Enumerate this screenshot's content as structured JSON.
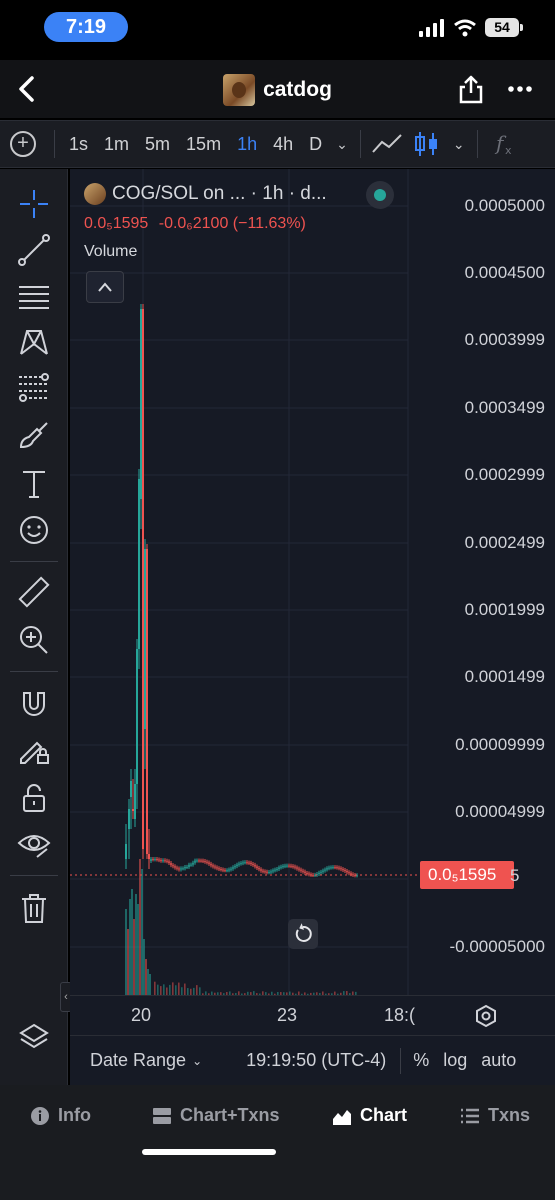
{
  "status_bar": {
    "time": "7:19",
    "battery": "54"
  },
  "header": {
    "title": "catdog"
  },
  "toolbar": {
    "intervals": [
      "1s",
      "1m",
      "5m",
      "15m",
      "1h",
      "4h",
      "D"
    ],
    "active_interval": "1h",
    "accent": "#3b82f6"
  },
  "legend": {
    "symbol": "COG/SOL on ... · 1h · d...",
    "price": "0.0₅1595",
    "change": "-0.0₆2100 (−11.63%)",
    "volume_label": "Volume",
    "down_color": "#ef5350",
    "up_color": "#26a69a"
  },
  "price_axis": {
    "labels": [
      "0.0005000",
      "0.0004500",
      "0.0003999",
      "0.0003499",
      "0.0002999",
      "0.0002499",
      "0.0001999",
      "0.0001499",
      "0.00009999",
      "0.00004999",
      "-0.00005000"
    ],
    "current_price_tag": "0.0₅1595",
    "current_price_tail": "5"
  },
  "time_axis": {
    "labels": [
      "20",
      "23",
      "18:("
    ]
  },
  "bottom_bar": {
    "date_range": "Date Range",
    "time": "19:19:50 (UTC-4)",
    "percent": "%",
    "log": "log",
    "auto": "auto"
  },
  "tabs": [
    {
      "label": "Info",
      "icon": "info-icon"
    },
    {
      "label": "Chart+Txns",
      "icon": "split-view-icon"
    },
    {
      "label": "Chart",
      "icon": "chart-icon",
      "active": true
    },
    {
      "label": "Txns",
      "icon": "list-icon"
    }
  ]
}
